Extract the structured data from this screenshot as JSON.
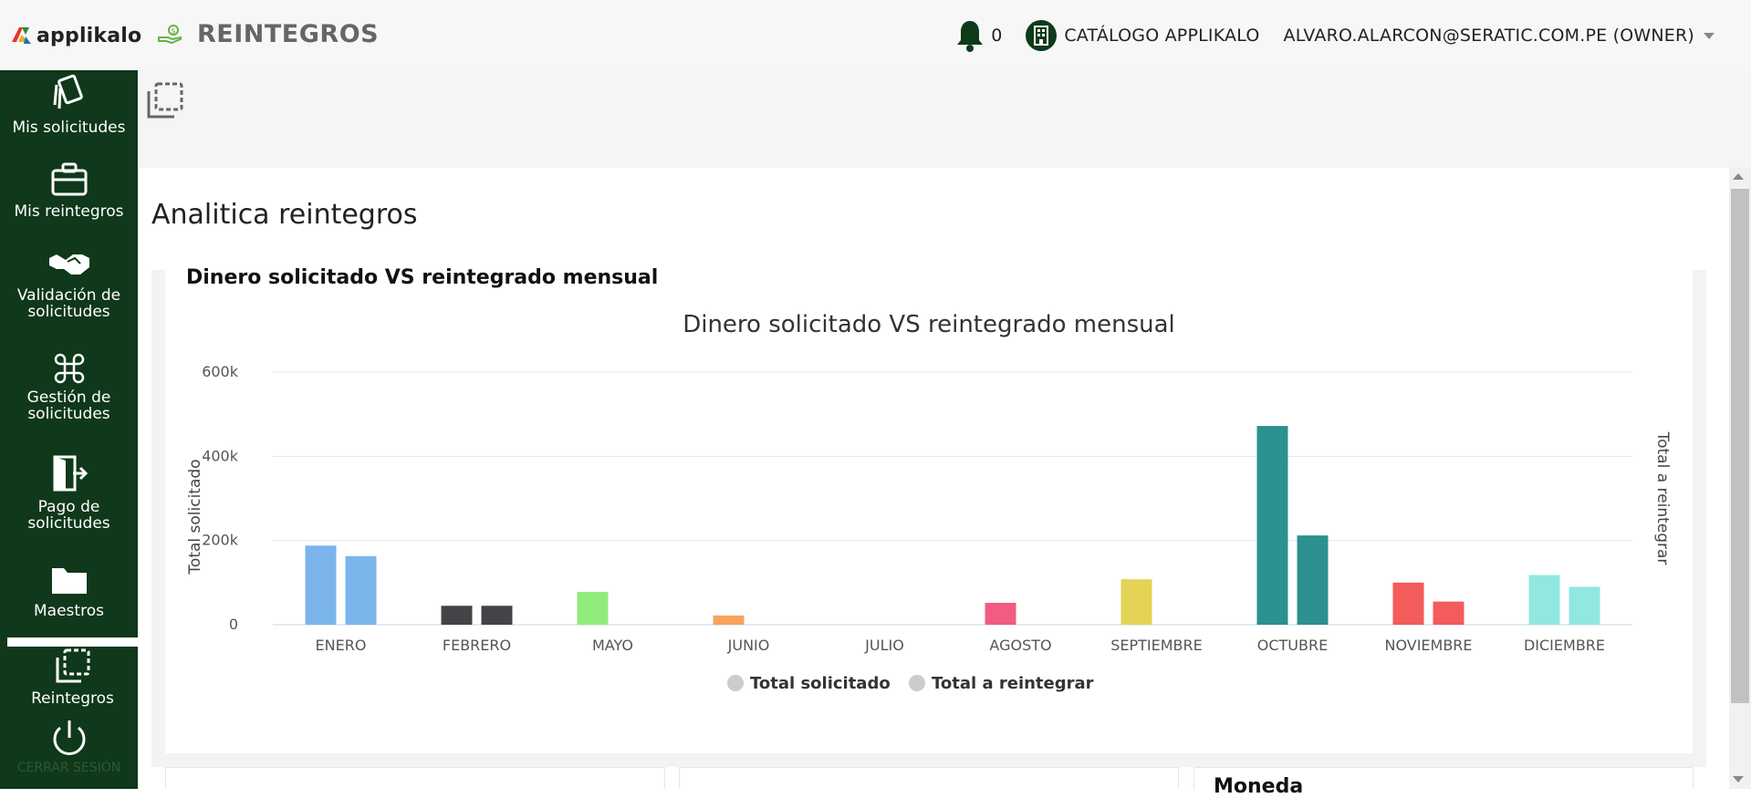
{
  "app": {
    "logo_text": "applikalo",
    "module_title": "REINTEGROS"
  },
  "header": {
    "notification_count": "0",
    "catalog_label": "CATÁLOGO APPLIKALO",
    "user_label": "ALVARO.ALARCON@SERATIC.COM.PE (OWNER)"
  },
  "sidebar": {
    "items": [
      {
        "label": "Mis solicitudes",
        "icon": "cards-icon"
      },
      {
        "label": "Mis reintegros",
        "icon": "briefcase-icon"
      },
      {
        "label": "Validación de solicitudes",
        "icon": "handshake-icon"
      },
      {
        "label": "Gestión de solicitudes",
        "icon": "command-icon"
      },
      {
        "label": "Pago de solicitudes",
        "icon": "exit-door-icon"
      },
      {
        "label": "Maestros",
        "icon": "folder-icon"
      },
      {
        "label": "Reintegros",
        "icon": "copy-dashed-icon"
      },
      {
        "label": "CERRAR SESIÓN",
        "icon": "power-icon"
      }
    ]
  },
  "page": {
    "title": "Analitica reintegros",
    "card_title": "Dinero solicitado VS reintegrado mensual",
    "bottom_card_label": "Moneda"
  },
  "colors": {
    "sidebar": "#10381a",
    "brand_green": "#2b8a2f"
  },
  "chart_data": {
    "type": "bar",
    "title": "Dinero solicitado VS reintegrado mensual",
    "ylabel": "Total solicitado",
    "y2label": "Total a reintegrar",
    "ylim": [
      0,
      600000
    ],
    "yticks": [
      "0",
      "200k",
      "400k",
      "600k"
    ],
    "categories": [
      "ENERO",
      "FEBRERO",
      "MAYO",
      "JUNIO",
      "JULIO",
      "AGOSTO",
      "SEPTIEMBRE",
      "OCTUBRE",
      "NOVIEMBRE",
      "DICIEMBRE"
    ],
    "category_colors": [
      "#7cb5ec",
      "#434348",
      "#90ed7d",
      "#f7a35c",
      "#8085e9",
      "#f15c80",
      "#e4d354",
      "#2b908f",
      "#f45b5b",
      "#91e8e1"
    ],
    "series": [
      {
        "name": "Total solicitado",
        "values": [
          188000,
          45000,
          78000,
          22000,
          0,
          52000,
          108000,
          472000,
          100000,
          118000
        ]
      },
      {
        "name": "Total a reintegrar",
        "values": [
          163000,
          45000,
          0,
          0,
          0,
          0,
          0,
          212000,
          55000,
          90000
        ]
      }
    ],
    "legend": "bottom-center",
    "grid": true
  }
}
